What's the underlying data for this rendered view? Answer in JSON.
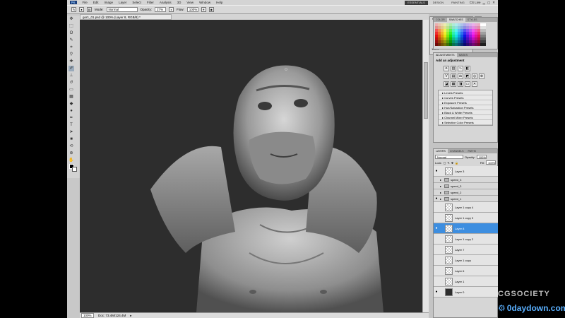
{
  "menubar": {
    "items": [
      "File",
      "Edit",
      "Image",
      "Layer",
      "Select",
      "Filter",
      "Analysis",
      "3D",
      "View",
      "Window",
      "Help"
    ],
    "workspaces": [
      "ESSENTIALS",
      "DESIGN",
      "PAINTING"
    ],
    "cs_live": "CS Live"
  },
  "options": {
    "mode_label": "Mode:",
    "mode_value": "Normal",
    "opacity_label": "Opacity:",
    "opacity_value": "27%",
    "flow_label": "Flow:",
    "flow_value": "100%"
  },
  "document": {
    "tab_title": "gor1_01.psd @ 100% (Layer 8, RGB/8) *",
    "zoom": "100%",
    "doc_info": "Doc: 73.4M/124.4M"
  },
  "navigator": {
    "tabs": [
      "NAVIGATOR",
      "HISTOGRAM",
      "INFO"
    ],
    "zoom": "100%"
  },
  "color_panel": {
    "tabs": [
      "COLOR",
      "SWATCHES",
      "STYLES"
    ]
  },
  "adjustments": {
    "tabs": [
      "ADJUSTMENTS",
      "MASKS"
    ],
    "heading": "Add an adjustment",
    "presets": [
      "Levels Presets",
      "Curves Presets",
      "Exposure Presets",
      "Hue/Saturation Presets",
      "Black & White Presets",
      "Channel Mixer Presets",
      "Selective Color Presets"
    ]
  },
  "layers_panel": {
    "tabs": [
      "LAYERS",
      "CHANNELS",
      "PATHS"
    ],
    "blend_mode": "Normal",
    "opacity_label": "Opacity:",
    "opacity_value": "100%",
    "lock_label": "Lock:",
    "fill_label": "Fill:",
    "fill_value": "100%",
    "layers": [
      {
        "name": "Layer 3",
        "kind": "layer",
        "visible": true,
        "selected": false
      },
      {
        "name": "speed_3",
        "kind": "group",
        "visible": false,
        "selected": false
      },
      {
        "name": "speed_3",
        "kind": "group",
        "visible": false,
        "selected": false
      },
      {
        "name": "speed_2",
        "kind": "group",
        "visible": false,
        "selected": false
      },
      {
        "name": "speed_1",
        "kind": "group",
        "visible": true,
        "selected": false
      },
      {
        "name": "Layer 1 copy 4",
        "kind": "layer",
        "visible": false,
        "selected": false
      },
      {
        "name": "Layer 1 copy 3",
        "kind": "layer",
        "visible": false,
        "selected": false
      },
      {
        "name": "Layer 8",
        "kind": "layer",
        "visible": true,
        "selected": true
      },
      {
        "name": "Layer 1 copy 2",
        "kind": "layer",
        "visible": false,
        "selected": false
      },
      {
        "name": "Layer 7",
        "kind": "layer",
        "visible": false,
        "selected": false
      },
      {
        "name": "Layer 1 copy",
        "kind": "layer",
        "visible": false,
        "selected": false
      },
      {
        "name": "Layer 6",
        "kind": "layer",
        "visible": false,
        "selected": false
      },
      {
        "name": "Layer 1",
        "kind": "layer",
        "visible": false,
        "selected": false
      },
      {
        "name": "Layer 0",
        "kind": "layer",
        "visible": true,
        "selected": false
      }
    ]
  },
  "watermark": {
    "brand": "CGSOCIETY",
    "site": "0daydown.com"
  }
}
